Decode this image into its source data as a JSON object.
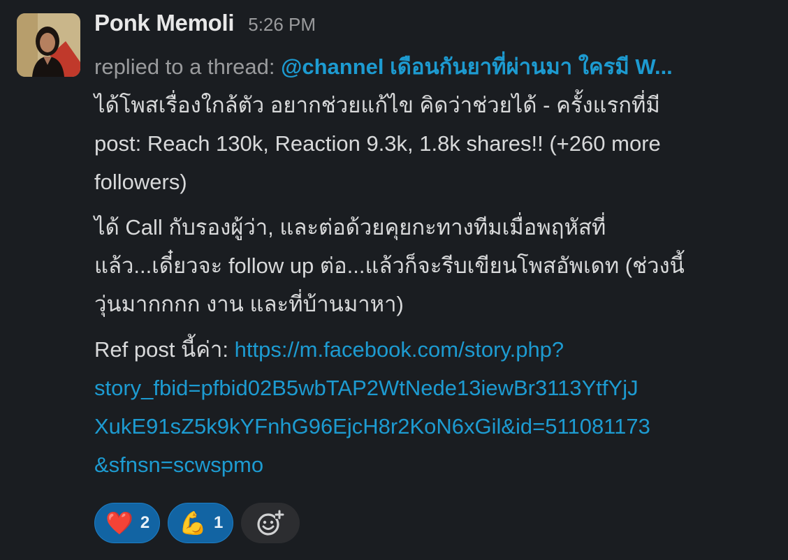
{
  "message": {
    "sender": "Ponk Memoli",
    "timestamp": "5:26 PM",
    "thread_prefix": "replied to a thread: ",
    "thread_title": "@channel เดือนกันยาที่ผ่านมา ใครมี W...",
    "paragraph1": [
      "ได้โพสเรื่องใกล้ตัว อยากช่วยแก้ไข คิดว่าช่วยได้ - ครั้งแรกที่มี",
      "post: Reach 130k, Reaction 9.3k, 1.8k shares!! (+260 more",
      "followers)"
    ],
    "paragraph2": [
      "ได้ Call กับรองผู้ว่า, และต่อด้วยคุยกะทางทีมเมื่อพฤหัสที่",
      "แล้ว...เดี๋ยวจะ follow up ต่อ...แล้วก็จะรีบเขียนโพสอัพเดท (ช่วงนี้",
      "วุ่นมากกกก งาน และที่บ้านมาหา)"
    ],
    "ref_label": "Ref post นี้ค่า: ",
    "ref_link_lines": [
      "https://m.facebook.com/story.php?",
      "story_fbid=pfbid02B5wbTAP2WtNede13iewBr3113YtfYjJ",
      "XukE91sZ5k9kYFnhG96EjcH8r2KoN6xGil&id=511081173",
      "&sfnsn=scwspmo"
    ]
  },
  "reactions": [
    {
      "emoji": "❤️",
      "icon": "red-heart",
      "count": "2"
    },
    {
      "emoji": "💪",
      "icon": "flexed-biceps",
      "count": "1"
    }
  ],
  "add_reaction_icon": "add-emoji-icon",
  "colors": {
    "background": "#1a1d21",
    "link": "#1d9bd1",
    "reaction_bg": "#1264a3",
    "muted": "#9a9b9d"
  }
}
